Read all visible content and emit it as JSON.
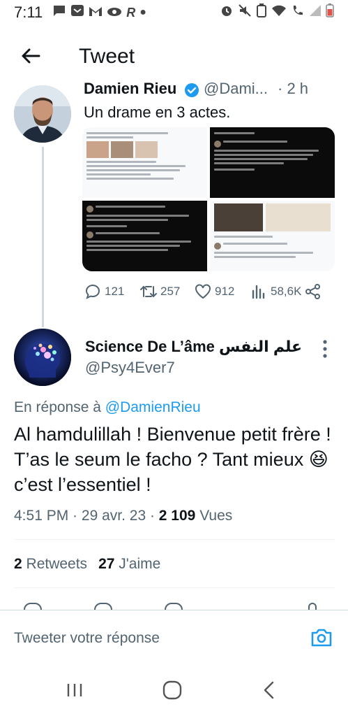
{
  "status_bar": {
    "time": "7:11",
    "icons_left": [
      "message-icon",
      "inbox-icon",
      "gmail-icon",
      "eye-icon",
      "r-app-icon",
      "dot-icon"
    ],
    "icons_right": [
      "alarm-icon",
      "mute-icon",
      "battery-saver-icon",
      "wifi-icon",
      "wifi-call-icon",
      "signal-icon",
      "battery-icon"
    ]
  },
  "header": {
    "title": "Tweet"
  },
  "parent_tweet": {
    "name": "Damien Rieu",
    "handle": "@Dami...",
    "time": "· 2 h",
    "text": "Un drame en 3 actes.",
    "replies": "121",
    "retweets": "257",
    "likes": "912",
    "views": "58,6K"
  },
  "main_tweet": {
    "name": "Science De L’âme علم النفس...",
    "handle": "@Psy4Ever7",
    "reply_prefix": "En réponse à ",
    "reply_to": "@DamienRieu",
    "text": "Al hamdulillah ! Bienvenue petit frère ! T’as le seum le facho ? Tant mieux 😆 c’est l’essentiel !",
    "time": "4:51 PM",
    "date": "29 avr. 23",
    "views_count": "2 109",
    "views_label": " Vues",
    "retweets_count": "2",
    "retweets_label": " Retweets",
    "likes_count": "27",
    "likes_label": " J'aime"
  },
  "reply_bar": {
    "placeholder": "Tweeter votre réponse"
  },
  "colors": {
    "accent": "#1d9bf0",
    "secondary_text": "#536471",
    "text": "#0f1419"
  }
}
